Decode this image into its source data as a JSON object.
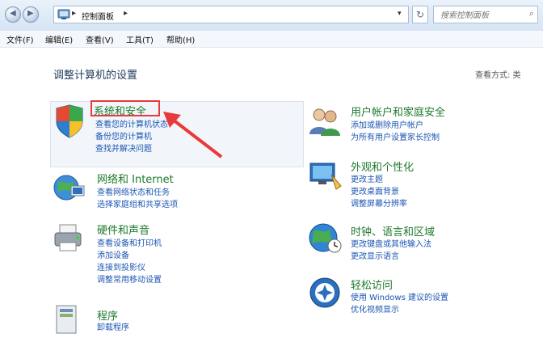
{
  "address": {
    "breadcrumb": [
      "控制面板"
    ],
    "search_placeholder": "搜索控制面板"
  },
  "menu": [
    "文件(F)",
    "编辑(E)",
    "查看(V)",
    "工具(T)",
    "帮助(H)"
  ],
  "page_title": "调整计算机的设置",
  "view_label": "查看方式: 类",
  "categories": [
    {
      "title": "系统和安全",
      "links": [
        "查看您的计算机状态",
        "备份您的计算机",
        "查找并解决问题"
      ]
    },
    {
      "title": "网络和 Internet",
      "links": [
        "查看网络状态和任务",
        "选择家庭组和共享选项"
      ]
    },
    {
      "title": "硬件和声音",
      "links": [
        "查看设备和打印机",
        "添加设备",
        "连接到投影仪",
        "调整常用移动设置"
      ]
    },
    {
      "title": "程序",
      "links": [
        "卸载程序"
      ]
    },
    {
      "title": "用户帐户和家庭安全",
      "links": [
        "添加或删除用户帐户",
        "为所有用户设置家长控制"
      ]
    },
    {
      "title": "外观和个性化",
      "links": [
        "更改主题",
        "更改桌面背景",
        "调整屏幕分辨率"
      ]
    },
    {
      "title": "时钟、语言和区域",
      "links": [
        "更改键盘或其他输入法",
        "更改显示语言"
      ]
    },
    {
      "title": "轻松访问",
      "links": [
        "使用 Windows 建议的设置",
        "优化视频显示"
      ]
    }
  ],
  "colors": {
    "title_green": "#1e7a2c",
    "link_blue": "#1b56b3",
    "highlight_red": "#e83a3a"
  }
}
